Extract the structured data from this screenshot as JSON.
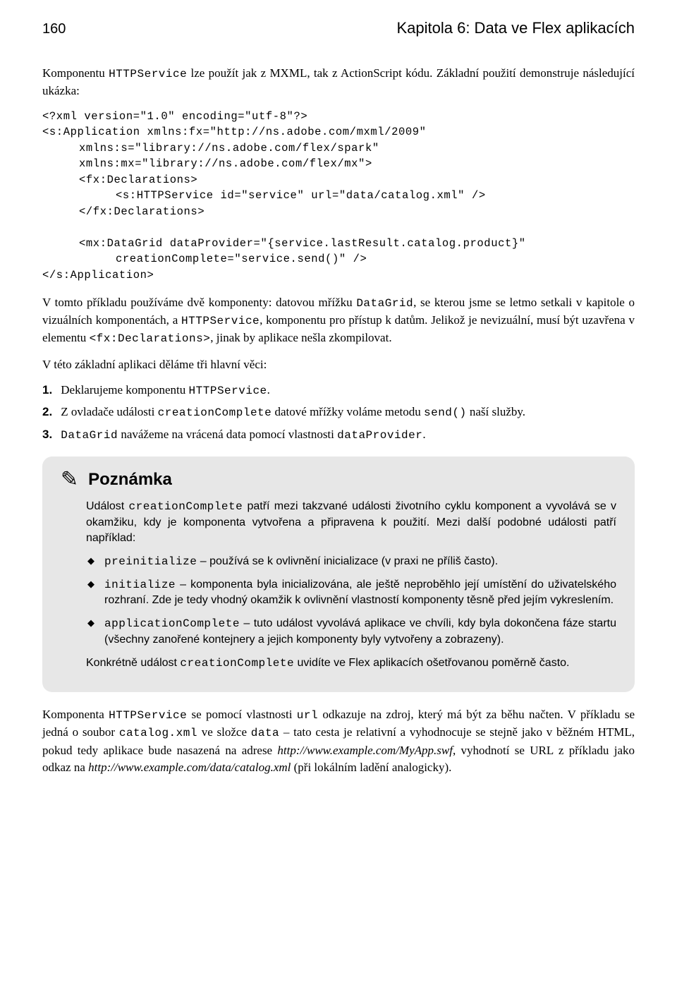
{
  "header": {
    "page_number": "160",
    "chapter_title": "Kapitola 6: Data ve Flex aplikacích"
  },
  "intro": {
    "t1": "Komponentu ",
    "c1": "HTTPService",
    "t2": " lze použít jak z MXML, tak z ActionScript kódu. Základní použití demonstruje následující ukázka:"
  },
  "code1": {
    "l1": "<?xml version=\"1.0\" encoding=\"utf-8\"?>",
    "l2": "<s:Application xmlns:fx=\"http://ns.adobe.com/mxml/2009\"",
    "l3": "xmlns:s=\"library://ns.adobe.com/flex/spark\"",
    "l4": "xmlns:mx=\"library://ns.adobe.com/flex/mx\">",
    "l5": "<fx:Declarations>",
    "l6": "<s:HTTPService id=\"service\" url=\"data/catalog.xml\" />",
    "l7": "</fx:Declarations>",
    "l8": "<mx:DataGrid dataProvider=\"{service.lastResult.catalog.product}\"",
    "l9": "creationComplete=\"service.send()\" />",
    "l10": "</s:Application>"
  },
  "para2": {
    "t1": "V tomto příkladu používáme dvě komponenty: datovou mřížku ",
    "c1": "DataGrid",
    "t2": ", se kterou jsme se letmo setkali v kapitole o vizuálních komponentách, a ",
    "c2": "HTTPService",
    "t3": ", komponentu pro přístup k datům. Jelikož je nevizuální, musí být uzavřena v elementu ",
    "c3": "<fx:Declarations>",
    "t4": ", jinak by aplikace nešla zkompilovat."
  },
  "para3": "V této základní aplikaci děláme tři hlavní věci:",
  "list": {
    "n1": "1.",
    "i1a": "Deklarujeme komponentu ",
    "i1b": "HTTPService",
    "i1c": ".",
    "n2": "2.",
    "i2a": "Z ovladače události ",
    "i2b": "creationComplete",
    "i2c": " datové mřížky voláme metodu ",
    "i2d": "send()",
    "i2e": " naší služby.",
    "n3": "3.",
    "i3a": "DataGrid",
    "i3b": " navážeme na vrácená data pomocí vlastnosti ",
    "i3c": "dataProvider",
    "i3d": "."
  },
  "note": {
    "title": "Poznámka",
    "p1a": "Událost ",
    "p1b": "creationComplete",
    "p1c": " patří mezi takzvané události životního cyklu komponent a vyvolává se v okamžiku, kdy je komponenta vytvořena a připravena k použití. Mezi další podobné události patří například:",
    "b1a": "preinitialize",
    "b1b": " – používá se k ovlivnění inicializace (v praxi ne příliš často).",
    "b2a": "initialize",
    "b2b": " – komponenta byla inicializována, ale ještě neproběhlo její umístění do uživatelského rozhraní. Zde je tedy vhodný okamžik k ovlivnění vlastností komponenty těsně před jejím vykreslením.",
    "b3a": "applicationComplete",
    "b3b": " – tuto událost vyvolává aplikace ve chvíli, kdy byla dokončena fáze startu (všechny zanořené kontejnery a jejich komponenty byly vytvořeny a zobrazeny).",
    "p2a": "Konkrétně událost ",
    "p2b": "creationComplete",
    "p2c": " uvidíte ve Flex aplikacích ošetřovanou poměrně často."
  },
  "para4": {
    "t1": "Komponenta ",
    "c1": "HTTPService",
    "t2": " se pomocí vlastnosti ",
    "c2": "url",
    "t3": " odkazuje na zdroj, který má být za běhu načten. V příkladu se jedná o soubor ",
    "c3": "catalog.xml",
    "t4": " ve složce ",
    "c4": "data",
    "t5": " – tato cesta je relativní a vyhodnocuje se stejně jako v běžném HTML, pokud tedy aplikace bude nasazená na adrese ",
    "i1": "http://www.example.com/MyApp.swf",
    "t6": ", vyhodnotí se URL z příkladu jako odkaz na ",
    "i2": "http://www.example.com/data/catalog.xml",
    "t7": " (při lokálním ladění analogicky)."
  }
}
